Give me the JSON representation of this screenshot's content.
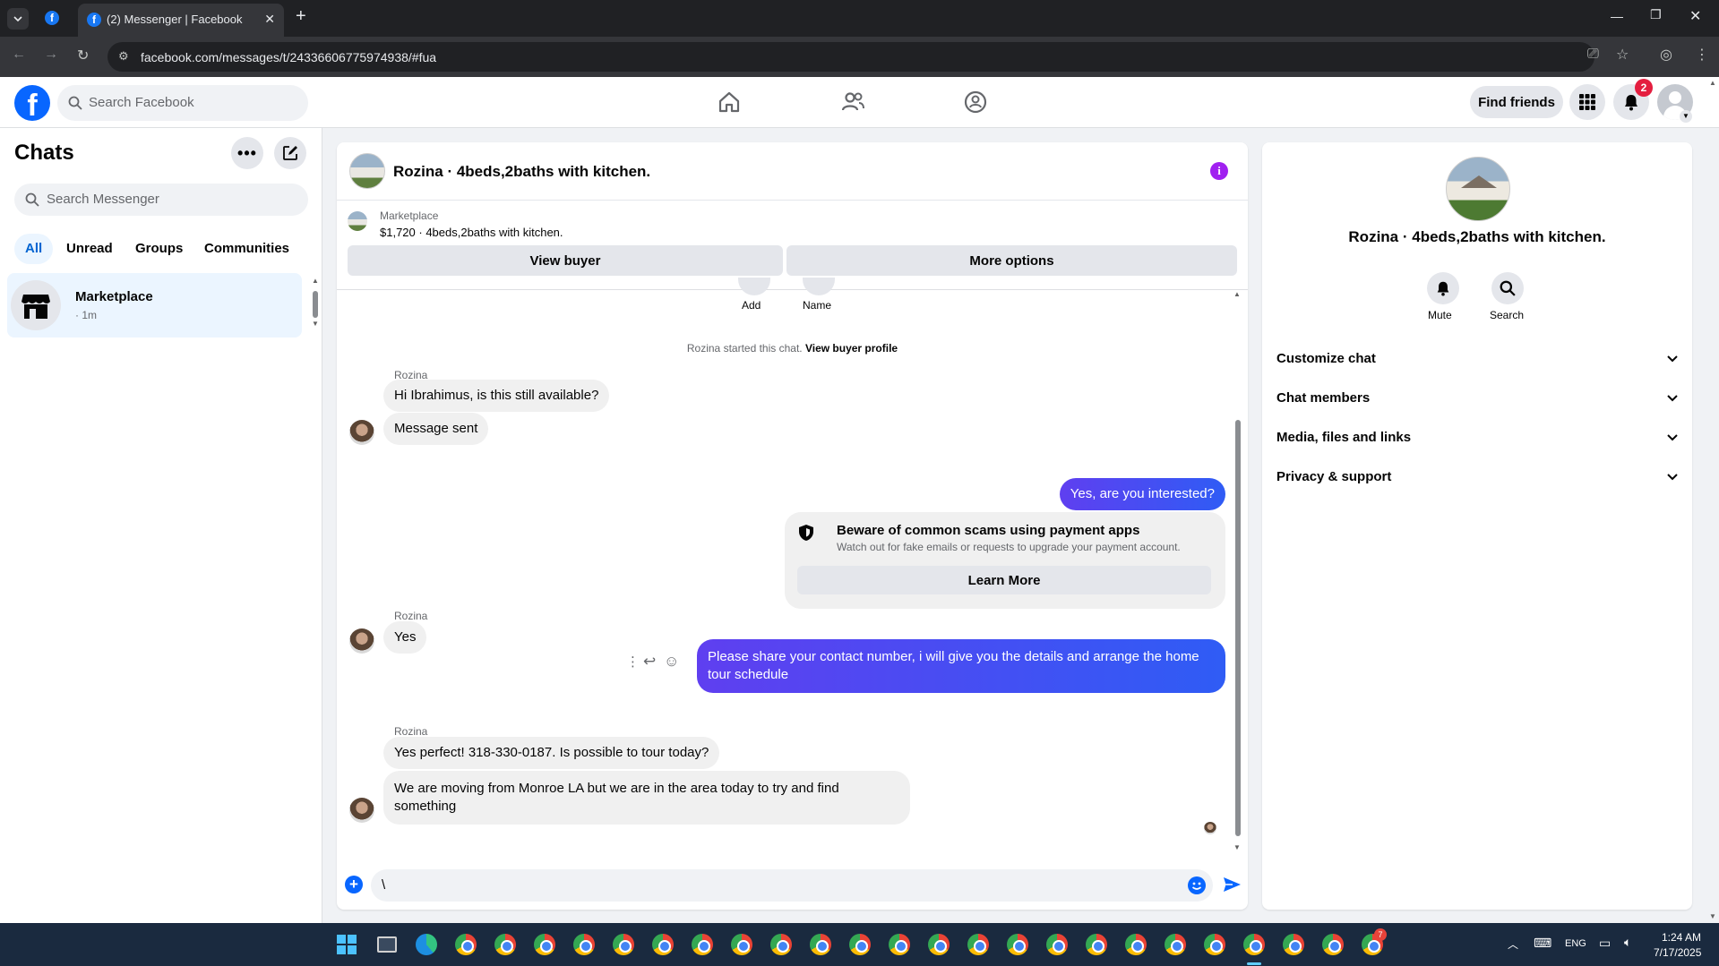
{
  "browser": {
    "tab_title": "(2) Messenger | Facebook",
    "url": "facebook.com/messages/t/24336606775974938/#fua"
  },
  "header": {
    "search_placeholder": "Search Facebook",
    "find_friends": "Find friends",
    "notification_count": "2"
  },
  "left": {
    "title": "Chats",
    "search_placeholder": "Search Messenger",
    "filters": [
      "All",
      "Unread",
      "Groups",
      "Communities"
    ],
    "chat_item": {
      "name": "Marketplace",
      "time": "· 1m"
    }
  },
  "conversation": {
    "title": "Rozina · 4beds,2baths with kitchen.",
    "listing": {
      "label": "Marketplace",
      "detail": "$1,720 · 4beds,2baths with kitchen.",
      "view_buyer": "View buyer",
      "more_options": "More options"
    },
    "top_actions": {
      "add": "Add",
      "name": "Name"
    },
    "system_text": "Rozina started this chat.",
    "system_link": "View buyer profile",
    "sender": "Rozina",
    "messages": {
      "m1": "Hi Ibrahimus, is this still available?",
      "m2": "Message sent",
      "m3": "Yes, are you interested?",
      "m4": "Yes",
      "m5": "Please share your contact number, i will give you the details and arrange the home tour schedule",
      "m6": "Yes perfect! 318-330-0187. Is possible to tour today?",
      "m7": "We are moving from Monroe LA but we are in the area today to try and find something"
    },
    "scam_card": {
      "title": "Beware of common scams using payment apps",
      "body": "Watch out for fake emails or requests to upgrade your payment account.",
      "button": "Learn More"
    },
    "composer_value": "\\"
  },
  "right": {
    "name": "Rozina · 4beds,2baths with kitchen.",
    "mute": "Mute",
    "search": "Search",
    "sections": [
      "Customize chat",
      "Chat members",
      "Media, files and links",
      "Privacy & support"
    ]
  },
  "taskbar": {
    "lang": "ENG",
    "time": "1:24 AM",
    "date": "7/17/2025",
    "chrome_badge": "7"
  },
  "colors": {
    "fb_blue": "#0866ff",
    "outgoing_gradient_start": "#5f3ff0",
    "outgoing_gradient_end": "#2f5cf5",
    "info_purple": "#a020f0",
    "notification_red": "#e41e3f"
  }
}
